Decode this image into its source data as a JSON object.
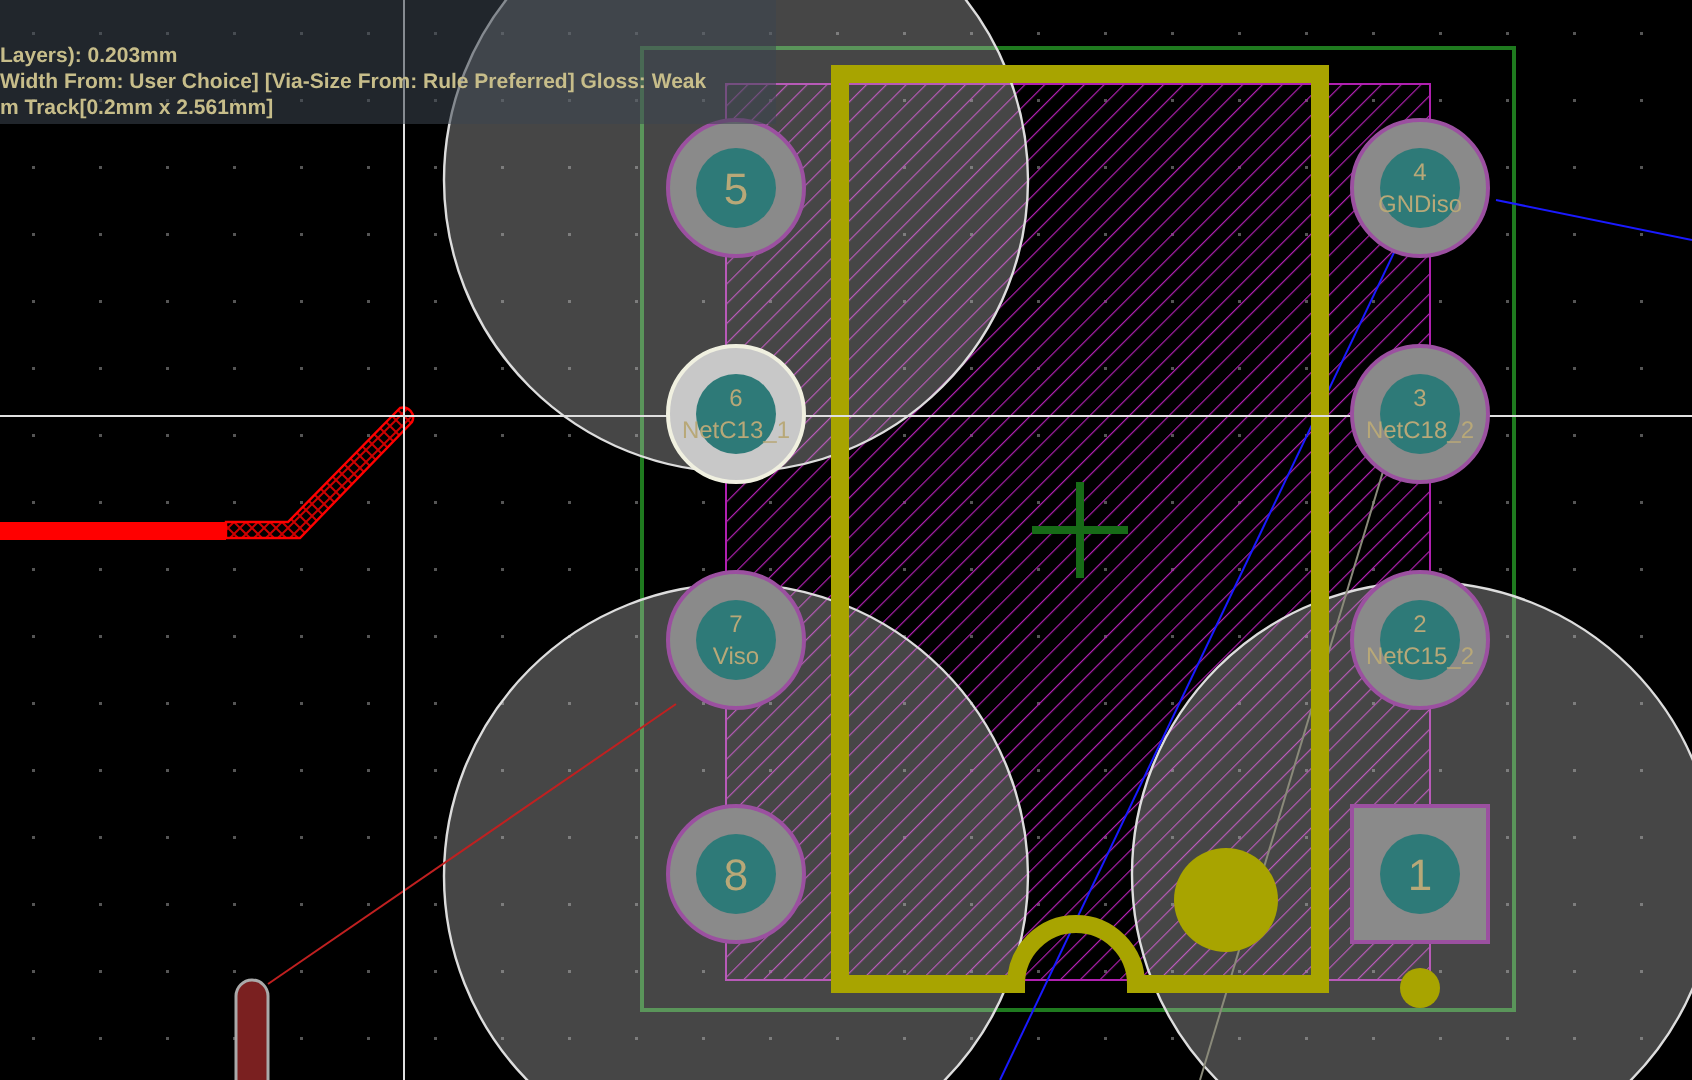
{
  "info_overlay": {
    "lines": [
      "Layers): 0.203mm",
      "Width From: User Choice] [Via-Size From: Rule Preferred] Gloss: Weak",
      "m Track[0.2mm x 2.561mm]"
    ]
  },
  "pads": [
    {
      "number": "5",
      "kind": "round",
      "highlighted": false
    },
    {
      "number": "6",
      "net": "NetC13_1",
      "kind": "round",
      "highlighted": true
    },
    {
      "number": "7",
      "net": "Viso",
      "kind": "round",
      "highlighted": false
    },
    {
      "number": "8",
      "kind": "round",
      "highlighted": false
    },
    {
      "number": "4",
      "net": "GNDiso",
      "kind": "round",
      "highlighted": false
    },
    {
      "number": "3",
      "net": "NetC18_2",
      "kind": "round",
      "highlighted": false
    },
    {
      "number": "2",
      "net": "NetC15_2",
      "kind": "round",
      "highlighted": false
    },
    {
      "number": "1",
      "kind": "square",
      "highlighted": false
    }
  ]
}
